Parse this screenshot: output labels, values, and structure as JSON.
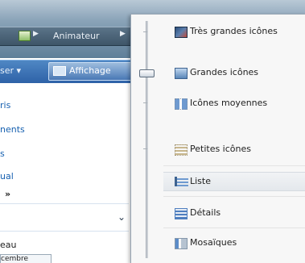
{
  "window": {
    "address_path": "Animateur",
    "toolbar_partial": "ser",
    "view_button_label": "Affichage"
  },
  "nav": {
    "links": [
      "ris",
      "nents",
      "s",
      "ual"
    ],
    "more": "»",
    "bottom_text": "eau",
    "bottom_tab": "cembre"
  },
  "view_menu": {
    "items": [
      {
        "label": "Très grandes icônes",
        "icon": "extra-large-icons-icon"
      },
      {
        "label": "Grandes icônes",
        "icon": "large-icons-icon"
      },
      {
        "label": "Icônes moyennes",
        "icon": "medium-icons-icon"
      },
      {
        "label": "Petites icônes",
        "icon": "small-icons-icon"
      },
      {
        "label": "Liste",
        "icon": "list-icon"
      },
      {
        "label": "Détails",
        "icon": "details-icon"
      },
      {
        "label": "Mosaïques",
        "icon": "tiles-icon"
      }
    ]
  },
  "colors": {
    "toolbar_blue": "#2e62a8",
    "link_blue": "#1660b0",
    "menu_bg": "#f7f7f7"
  }
}
